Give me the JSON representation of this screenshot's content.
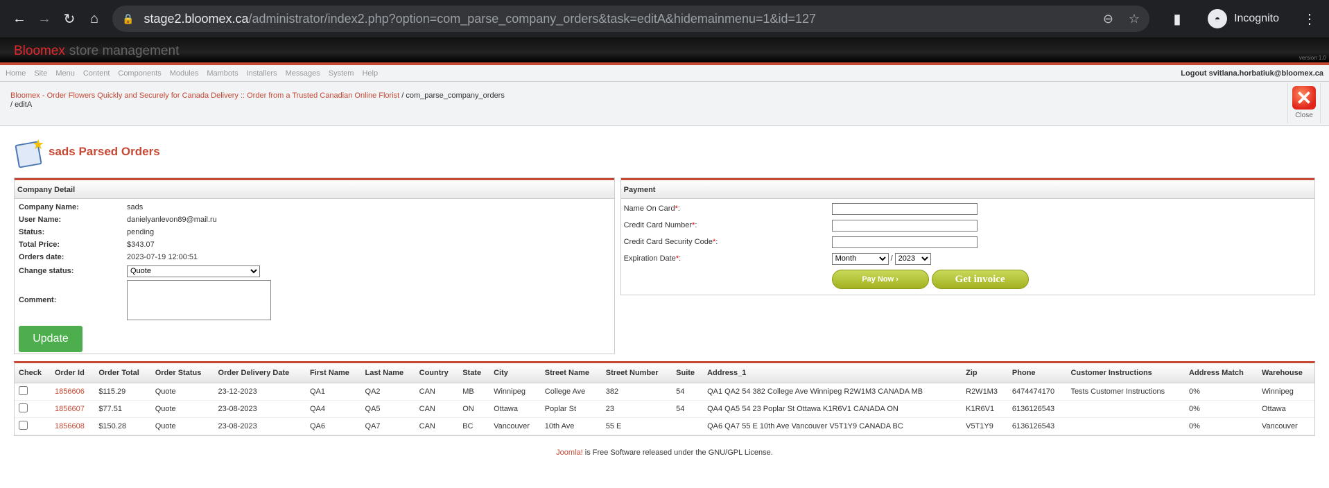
{
  "browser": {
    "url_host": "stage2.bloomex.ca",
    "url_path": "/administrator/index2.php?option=com_parse_company_orders&task=editA&hidemainmenu=1&id=127",
    "profile_label": "Incognito"
  },
  "header": {
    "brand_red": "Bloomex",
    "brand_grey": "store management",
    "version": "version 1.0"
  },
  "menu": {
    "items": [
      "Home",
      "Site",
      "Menu",
      "Content",
      "Components",
      "Modules",
      "Mambots",
      "Installers",
      "Messages",
      "System",
      "Help"
    ],
    "logout": "Logout svitlana.horbatiuk@bloomex.ca"
  },
  "pathway": {
    "link": "Bloomex - Order Flowers Quickly and Securely for Canada Delivery :: Order from a Trusted Canadian Online Florist",
    "rest": " / com_parse_company_orders",
    "line2": "/ editA",
    "close_label": "Close"
  },
  "title": "sads Parsed Orders",
  "company": {
    "heading": "Company Detail",
    "name_label": "Company Name:",
    "name": "sads",
    "user_label": "User Name:",
    "user": "danielyanlevon89@mail.ru",
    "status_label": "Status:",
    "status": "pending",
    "price_label": "Total Price:",
    "price": "$343.07",
    "date_label": "Orders date:",
    "date": "2023-07-19 12:00:51",
    "change_label": "Change status:",
    "change_value": "Quote",
    "comment_label": "Comment:",
    "update_label": "Update"
  },
  "payment": {
    "heading": "Payment",
    "name_on_card": "Name On Card",
    "cc_number": "Credit Card Number",
    "cc_code": "Credit Card Security Code",
    "exp_date": "Expiration Date",
    "required": "*",
    "colon": ":",
    "month_value": "Month",
    "slash": "/",
    "year_value": "2023",
    "pay_now": "Pay Now ›",
    "get_invoice": "Get invoice"
  },
  "table": {
    "columns": [
      "Check",
      "Order Id",
      "Order Total",
      "Order Status",
      "Order Delivery Date",
      "First Name",
      "Last Name",
      "Country",
      "State",
      "City",
      "Street Name",
      "Street Number",
      "Suite",
      "Address_1",
      "Zip",
      "Phone",
      "Customer Instructions",
      "Address Match",
      "Warehouse"
    ],
    "rows": [
      {
        "id": "1856606",
        "total": "$115.29",
        "status": "Quote",
        "date": "23-12-2023",
        "first": "QA1",
        "last": "QA2",
        "country": "CAN",
        "state": "MB",
        "city": "Winnipeg",
        "street": "College Ave",
        "number": "382",
        "suite": "54",
        "address": "QA1 QA2 54 382 College Ave Winnipeg R2W1M3 CANADA MB",
        "zip": "R2W1M3",
        "phone": "6474474170",
        "instructions": "Tests Customer Instructions",
        "match": "0%",
        "warehouse": "Winnipeg"
      },
      {
        "id": "1856607",
        "total": "$77.51",
        "status": "Quote",
        "date": "23-08-2023",
        "first": "QA4",
        "last": "QA5",
        "country": "CAN",
        "state": "ON",
        "city": "Ottawa",
        "street": "Poplar St",
        "number": "23",
        "suite": "54",
        "address": "QA4 QA5 54 23 Poplar St Ottawa K1R6V1 CANADA ON",
        "zip": "K1R6V1",
        "phone": "6136126543",
        "instructions": "",
        "match": "0%",
        "warehouse": "Ottawa"
      },
      {
        "id": "1856608",
        "total": "$150.28",
        "status": "Quote",
        "date": "23-08-2023",
        "first": "QA6",
        "last": "QA7",
        "country": "CAN",
        "state": "BC",
        "city": "Vancouver",
        "street": "10th Ave",
        "number": "55 E",
        "suite": "",
        "address": "QA6 QA7 55 E 10th Ave Vancouver V5T1Y9 CANADA BC",
        "zip": "V5T1Y9",
        "phone": "6136126543",
        "instructions": "",
        "match": "0%",
        "warehouse": "Vancouver"
      }
    ]
  },
  "footer": {
    "link": "Joomla!",
    "text": " is Free Software released under the GNU/GPL License."
  }
}
